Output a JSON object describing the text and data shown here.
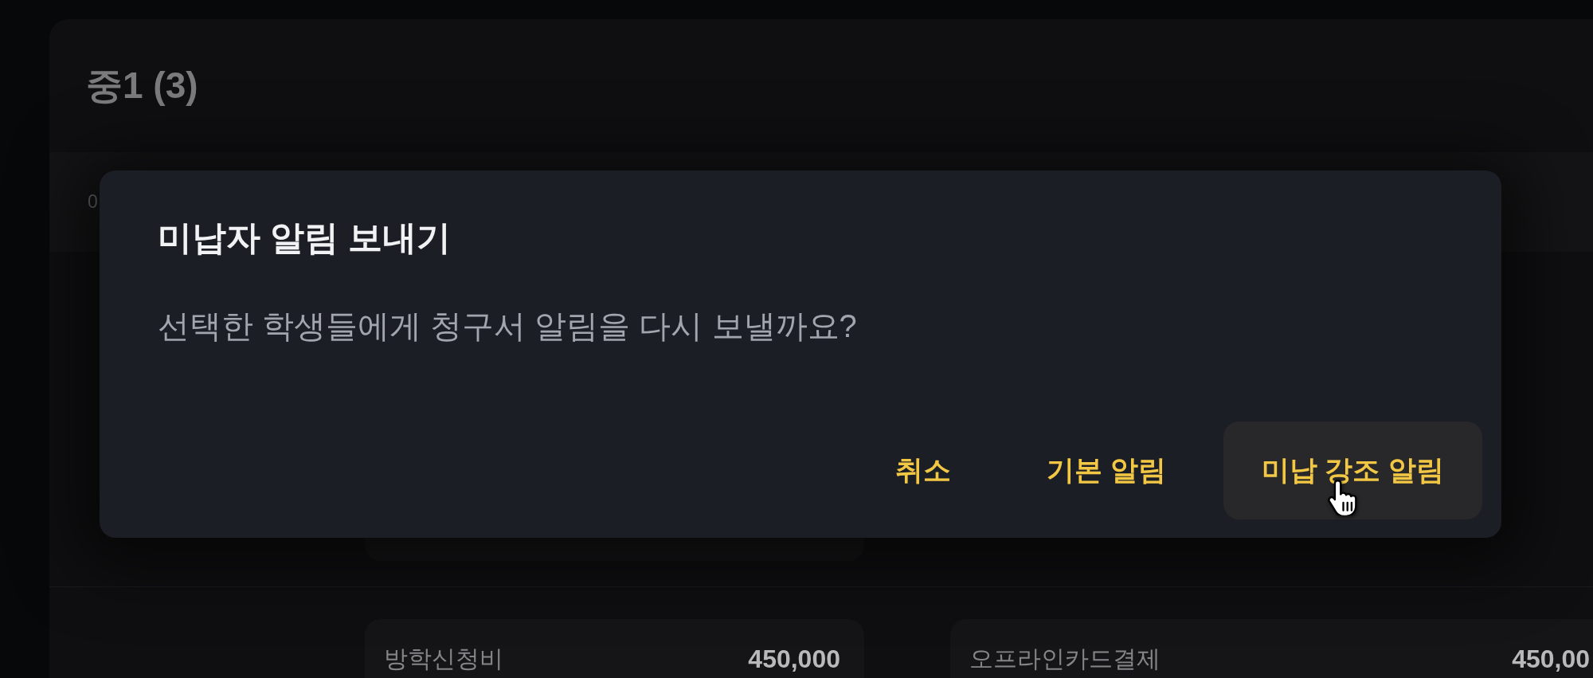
{
  "panel": {
    "title": "중1 (3)",
    "summary_strip": {
      "text": "0"
    },
    "charge_cards": [
      {
        "label": "방학신청비",
        "amount": "450,000"
      },
      {
        "label": "오프라인카드결제",
        "amount": "450,00"
      }
    ]
  },
  "dialog": {
    "title": "미납자 알림 보내기",
    "message": "선택한 학생들에게 청구서 알림을 다시 보낼까요?",
    "buttons": [
      {
        "label": "취소",
        "hovered": false
      },
      {
        "label": "기본 알림",
        "hovered": false
      },
      {
        "label": "미납 강조 알림",
        "hovered": true
      }
    ]
  }
}
